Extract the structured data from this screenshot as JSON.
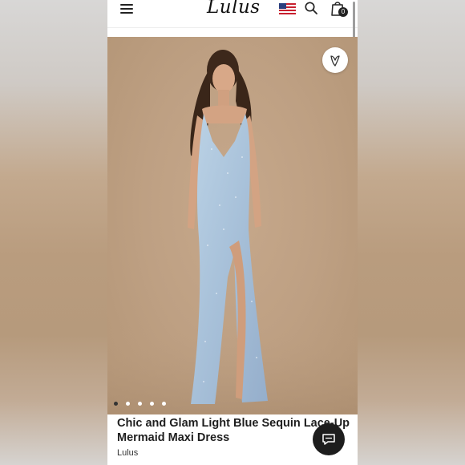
{
  "header": {
    "logo_text": "Lulus",
    "cart_count": "0",
    "icons": [
      "menu-icon",
      "us-flag-icon",
      "search-icon",
      "shopping-bag-icon"
    ]
  },
  "gallery": {
    "image_count": 5,
    "active_index": 0,
    "wishlist_icon": "heart-v-icon"
  },
  "product": {
    "title_line_1": "Chic and Glam Light Blue Sequin Lace-Up",
    "title_line_2": "Mermaid Maxi Dress",
    "brand": "Lulus"
  },
  "chat": {
    "icon": "chat-bubble-icon"
  },
  "colors": {
    "accent_dark": "#1d1d1d",
    "photo_background": "#bea083",
    "dress": "#a9c4dc"
  }
}
